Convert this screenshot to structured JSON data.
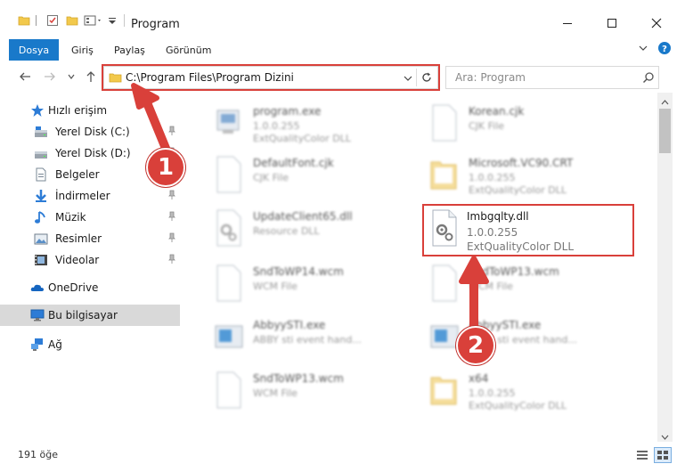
{
  "window": {
    "title": "Program"
  },
  "ribbon": {
    "tabs": [
      "Dosya",
      "Giriş",
      "Paylaş",
      "Görünüm"
    ]
  },
  "address": {
    "path": "C:\\Program Files\\Program Dizini",
    "search_placeholder": "Ara: Program"
  },
  "nav": {
    "quick_access": "Hızlı erişim",
    "items": [
      {
        "label": "Yerel Disk (C:)",
        "icon": "drive-icon"
      },
      {
        "label": "Yerel Disk (D:)",
        "icon": "drive-icon"
      },
      {
        "label": "Belgeler",
        "icon": "documents-icon"
      },
      {
        "label": "İndirmeler",
        "icon": "downloads-icon"
      },
      {
        "label": "Müzik",
        "icon": "music-icon"
      },
      {
        "label": "Resimler",
        "icon": "pictures-icon"
      },
      {
        "label": "Videolar",
        "icon": "videos-icon"
      }
    ],
    "onedrive": "OneDrive",
    "this_pc": "Bu bilgisayar",
    "network": "Ağ"
  },
  "files": [
    {
      "name": "program.exe",
      "line1": "1.0.0.255",
      "line2": "ExtQualityColor DLL",
      "icon": "exe-icon"
    },
    {
      "name": "Korean.cjk",
      "line1": "CJK File",
      "line2": "",
      "icon": "file-icon"
    },
    {
      "name": "DefaultFont.cjk",
      "line1": "CJK File",
      "line2": "",
      "icon": "file-icon"
    },
    {
      "name": "Microsoft.VC90.CRT",
      "line1": "1.0.0.255",
      "line2": "ExtQualityColor DLL",
      "icon": "folder-icon"
    },
    {
      "name": "UpdateClient65.dll",
      "line1": "Resource DLL",
      "line2": "",
      "icon": "dll-icon"
    },
    {
      "name": "Imbgqlty.dll",
      "line1": "1.0.0.255",
      "line2": "ExtQualityColor DLL",
      "icon": "dll-icon"
    },
    {
      "name": "SndToWP14.wcm",
      "line1": "WCM File",
      "line2": "",
      "icon": "file-icon"
    },
    {
      "name": "SndToWP13.wcm",
      "line1": "WCM File",
      "line2": "",
      "icon": "file-icon"
    },
    {
      "name": "AbbyySTI.exe",
      "line1": "ABBY sti event hand...",
      "line2": "",
      "icon": "app-icon"
    },
    {
      "name": "AbbyySTI.exe",
      "line1": "ABBY sti event hand...",
      "line2": "",
      "icon": "app-icon"
    },
    {
      "name": "SndToWP13.wcm",
      "line1": "WCM File",
      "line2": "",
      "icon": "file-icon"
    },
    {
      "name": "x64",
      "line1": "1.0.0.255",
      "line2": "ExtQualityColor DLL",
      "icon": "folder-icon"
    }
  ],
  "status": {
    "count": "191 öğe"
  },
  "annotations": {
    "step1": "1",
    "step2": "2"
  },
  "colors": {
    "accent": "#1979ca",
    "highlight": "#d9403a"
  }
}
